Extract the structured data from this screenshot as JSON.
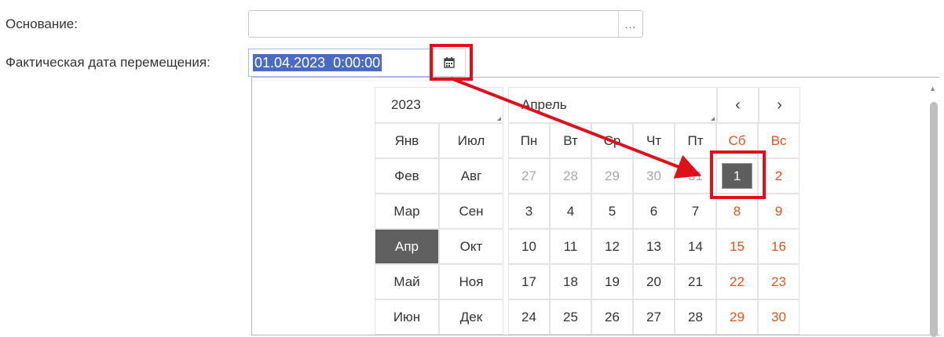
{
  "form": {
    "basis_label": "Основание:",
    "basis_value": "",
    "basis_button": "...",
    "date_label": "Фактическая дата перемещения:",
    "date_value": "01.04.2023  0:00:00"
  },
  "calendar": {
    "year": "2023",
    "month": "Апрель",
    "prev_icon": "‹",
    "next_icon": "›",
    "months_left": [
      "Янв",
      "Фев",
      "Мар",
      "Апр",
      "Май",
      "Июн"
    ],
    "months_right": [
      "Июл",
      "Авг",
      "Сен",
      "Окт",
      "Ноя",
      "Дек"
    ],
    "active_month": "Апр",
    "weekdays": [
      "Пн",
      "Вт",
      "Ср",
      "Чт",
      "Пт",
      "Сб",
      "Вс"
    ],
    "weeks": [
      [
        "27",
        "28",
        "29",
        "30",
        "31",
        "1",
        "2"
      ],
      [
        "3",
        "4",
        "5",
        "6",
        "7",
        "8",
        "9"
      ],
      [
        "10",
        "11",
        "12",
        "13",
        "14",
        "15",
        "16"
      ],
      [
        "17",
        "18",
        "19",
        "20",
        "21",
        "22",
        "23"
      ],
      [
        "24",
        "25",
        "26",
        "27",
        "28",
        "29",
        "30"
      ]
    ],
    "selected_day": "1"
  },
  "colors": {
    "weekend": "#e8511e",
    "selection": "#4a6bc4",
    "highlight": "#e0101a"
  }
}
